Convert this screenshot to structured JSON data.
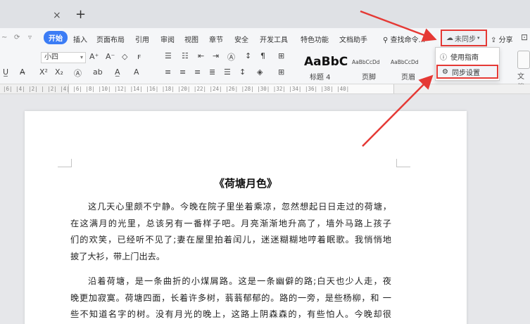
{
  "tabs": {
    "close_glyph": "×",
    "new_glyph": "+"
  },
  "menubar": {
    "items": [
      "开始",
      "插入",
      "页面布局",
      "引用",
      "审阅",
      "视图",
      "章节",
      "安全",
      "开发工具",
      "特色功能",
      "文档助手"
    ],
    "search_label": "查找命令...",
    "sync_label": "未同步",
    "share_label": "分享"
  },
  "ribbon": {
    "font_size": "小四",
    "style_samples": [
      {
        "sample": "AaBbC",
        "name": "标题 4"
      },
      {
        "sample": "AaBbCcDd",
        "name": "页脚"
      },
      {
        "sample": "AaBbCcDd",
        "name": "页眉"
      }
    ],
    "side_label": "文档"
  },
  "ruler": {
    "ticks": "|6| |4| |2| | |2| |4| |6| |8| |10| |12| |14| |16| |18| |20| |22| |24| |26| |28| |30| |32| |34| |36| |38| |40|"
  },
  "sync_menu": {
    "items": [
      {
        "label": "使用指南",
        "icon": "info-icon"
      },
      {
        "label": "同步设置",
        "icon": "gear-icon"
      }
    ]
  },
  "document": {
    "title": "《荷塘月色》",
    "paragraphs": [
      [
        "这几天心里颇不宁静。今晚在院子里坐着乘凉，忽然想起日日走过的荷塘，",
        "在这满月的光里，总该另有一番样子吧。月亮渐渐地升高了，墙外马路上孩子",
        "们的欢笑，已经听不见了;妻在屋里拍着闰儿，迷迷糊糊地哼着眠歌。我悄悄地",
        "披了大衫，带上门出去。"
      ],
      [
        "沿着荷塘，是一条曲折的小煤屑路。这是一条幽僻的路;白天也少人走，夜",
        "晚更加寂寞。荷塘四面，长着许多树，蓊蓊郁郁的。路的一旁，是些杨柳，和  一",
        "些不知道名字的树。没有月光的晚上，这路上阴森森的，有些怕人。今晚却很"
      ]
    ]
  },
  "colors": {
    "accent": "#3b7cf5",
    "highlight_red": "#e53935"
  }
}
